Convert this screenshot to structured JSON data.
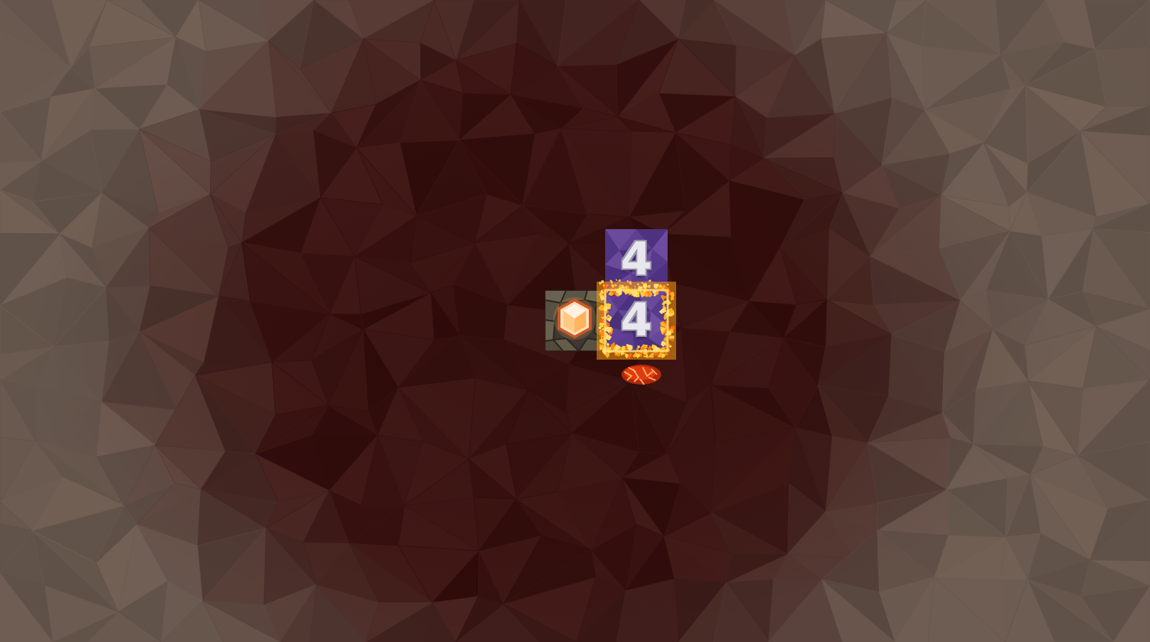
{
  "board": {
    "tiles": [
      {
        "kind": "number",
        "value": "4",
        "state": "idle",
        "color": "#5a3a8a"
      },
      {
        "kind": "number",
        "value": "4",
        "state": "burning",
        "color": "#5a3a8a"
      },
      {
        "kind": "gem",
        "value": "",
        "state": "idle",
        "color": "#4a4338"
      }
    ]
  },
  "theme": {
    "background_dark": "#3a1714",
    "background_light": "#6a5a52",
    "fire_color": "#ffb020",
    "lava_color": "#e03a10"
  }
}
